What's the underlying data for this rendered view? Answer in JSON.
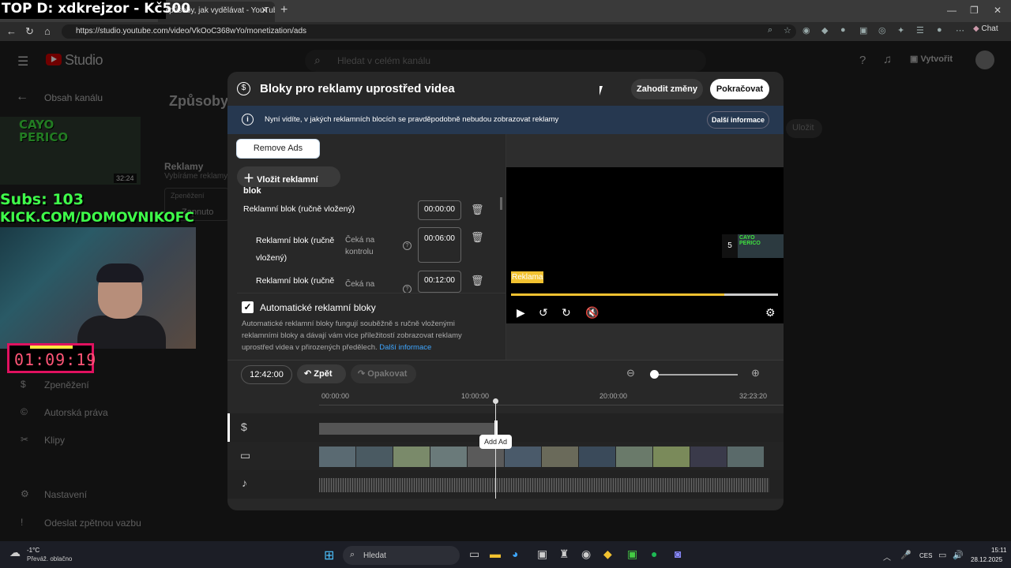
{
  "browser": {
    "tab_active_title": "Způsoby, jak vydělávat - YouTube",
    "tab_close": "✕",
    "tab_new": "+",
    "url": "https://studio.youtube.com/video/VkOoC368wYo/monetization/ads",
    "chat_label": "Chat",
    "win_min": "—",
    "win_max": "❐",
    "win_close": "✕"
  },
  "stream_overlay": {
    "title": "TOP D: xdkrejzor - Kč500",
    "subs": "Subs: 103",
    "kick": "KICK.COM/DOMOVNIKOFC",
    "timer": "01:09:19",
    "thumb_text": "CAYO PERICO",
    "thumb_duration": "32:24"
  },
  "studio": {
    "logo_text": "Studio",
    "search_placeholder": "Hledat v celém kanálu",
    "create_label": "Vytvořit",
    "back_label": "Obsah kanálu",
    "page_title": "Způsoby, j",
    "reklamy_label": "Reklamy",
    "reklamy_sub": "Vybíráme reklamy t",
    "zpen_label": "Zpeněžení",
    "zapnuto": "Zapnuto",
    "ulozit": "Uložit",
    "sidebar": [
      {
        "label": "Zpeněžení",
        "icon": "dollar-icon",
        "glyph": "$"
      },
      {
        "label": "Autorská práva",
        "icon": "copyright-icon",
        "glyph": "©"
      },
      {
        "label": "Klipy",
        "icon": "scissors-icon",
        "glyph": "✂"
      },
      {
        "label": "Nastavení",
        "icon": "gear-icon",
        "glyph": "⚙"
      },
      {
        "label": "Odeslat zpětnou vazbu",
        "icon": "feedback-icon",
        "glyph": "!"
      }
    ]
  },
  "modal": {
    "title": "Bloky pro reklamy uprostřed videa",
    "discard": "Zahodit změny",
    "continue": "Pokračovat",
    "info_text": "Nyní vidíte, v jakých reklamních blocích se pravděpodobně nebudou zobrazovat reklamy",
    "info_more": "Další informace",
    "remove_ads": "Remove Ads",
    "insert_block": "Vložit reklamní blok",
    "ad_blocks": [
      {
        "label": "Reklamní blok (ručně vložený)",
        "time": "00:00:00",
        "status": ""
      },
      {
        "label": "Reklamní blok (ručně vložený)",
        "time": "00:06:00",
        "status": "Čeká na kontrolu"
      },
      {
        "label": "Reklamní blok (ručně",
        "time": "00:12:00",
        "status": "Čeká na"
      }
    ],
    "auto_label": "Automatické reklamní bloky",
    "auto_desc": "Automatické reklamní bloky fungují souběžně s ručně vloženými reklamními bloky a dávají vám více příležitostí zobrazovat reklamy uprostřed videa v přirozených předělech.",
    "auto_link": "Další informace",
    "preview": {
      "upnext_num": "5",
      "reklama_badge": "Reklama",
      "progress": 0.8
    },
    "toolbar": {
      "current_time": "12:42:00",
      "undo": "Zpět",
      "redo": "Opakovat"
    },
    "timeline": {
      "ticks": [
        "00:00:00",
        "10:00:00",
        "20:00:00",
        "32:23:20"
      ],
      "add_ad_tip": "Add Ad"
    }
  },
  "taskbar": {
    "temp": "-1°C",
    "weather": "Převáž. oblačno",
    "search": "Hledat",
    "lang": "CES",
    "time": "15:11",
    "date": "28.12.2025"
  }
}
